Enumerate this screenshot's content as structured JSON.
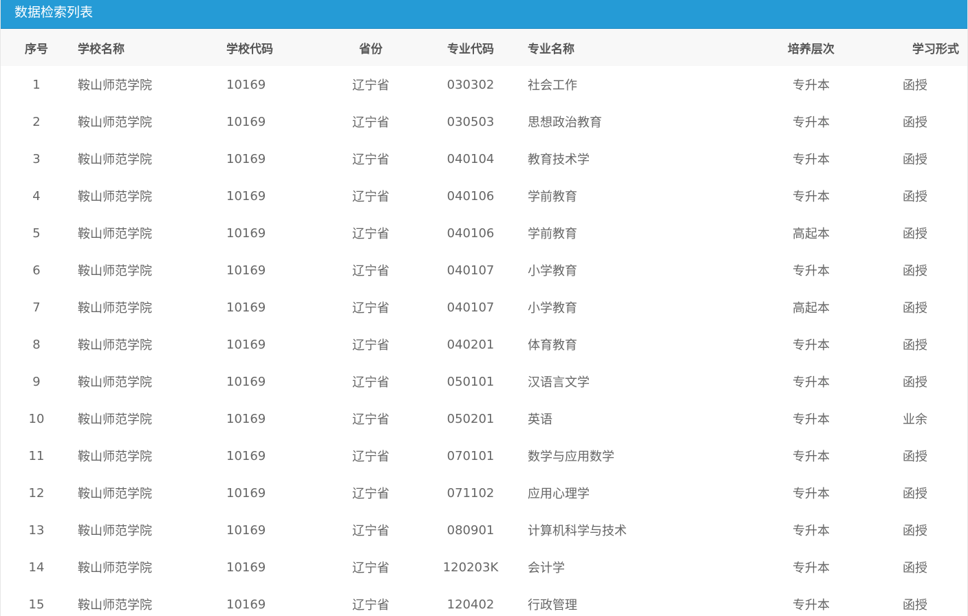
{
  "header": {
    "title": "数据检索列表"
  },
  "table": {
    "columns": [
      "序号",
      "学校名称",
      "学校代码",
      "省份",
      "专业代码",
      "专业名称",
      "培养层次",
      "学习形式"
    ],
    "rows": [
      [
        "1",
        "鞍山师范学院",
        "10169",
        "辽宁省",
        "030302",
        "社会工作",
        "专升本",
        "函授"
      ],
      [
        "2",
        "鞍山师范学院",
        "10169",
        "辽宁省",
        "030503",
        "思想政治教育",
        "专升本",
        "函授"
      ],
      [
        "3",
        "鞍山师范学院",
        "10169",
        "辽宁省",
        "040104",
        "教育技术学",
        "专升本",
        "函授"
      ],
      [
        "4",
        "鞍山师范学院",
        "10169",
        "辽宁省",
        "040106",
        "学前教育",
        "专升本",
        "函授"
      ],
      [
        "5",
        "鞍山师范学院",
        "10169",
        "辽宁省",
        "040106",
        "学前教育",
        "高起本",
        "函授"
      ],
      [
        "6",
        "鞍山师范学院",
        "10169",
        "辽宁省",
        "040107",
        "小学教育",
        "专升本",
        "函授"
      ],
      [
        "7",
        "鞍山师范学院",
        "10169",
        "辽宁省",
        "040107",
        "小学教育",
        "高起本",
        "函授"
      ],
      [
        "8",
        "鞍山师范学院",
        "10169",
        "辽宁省",
        "040201",
        "体育教育",
        "专升本",
        "函授"
      ],
      [
        "9",
        "鞍山师范学院",
        "10169",
        "辽宁省",
        "050101",
        "汉语言文学",
        "专升本",
        "函授"
      ],
      [
        "10",
        "鞍山师范学院",
        "10169",
        "辽宁省",
        "050201",
        "英语",
        "专升本",
        "业余"
      ],
      [
        "11",
        "鞍山师范学院",
        "10169",
        "辽宁省",
        "070101",
        "数学与应用数学",
        "专升本",
        "函授"
      ],
      [
        "12",
        "鞍山师范学院",
        "10169",
        "辽宁省",
        "071102",
        "应用心理学",
        "专升本",
        "函授"
      ],
      [
        "13",
        "鞍山师范学院",
        "10169",
        "辽宁省",
        "080901",
        "计算机科学与技术",
        "专升本",
        "函授"
      ],
      [
        "14",
        "鞍山师范学院",
        "10169",
        "辽宁省",
        "120203K",
        "会计学",
        "专升本",
        "函授"
      ],
      [
        "15",
        "鞍山师范学院",
        "10169",
        "辽宁省",
        "120402",
        "行政管理",
        "专升本",
        "函授"
      ]
    ]
  },
  "colors": {
    "header_bg": "#259bd6",
    "header_text": "#ffffff",
    "thead_bg": "#f8f8f8",
    "cell_text": "#666666"
  }
}
